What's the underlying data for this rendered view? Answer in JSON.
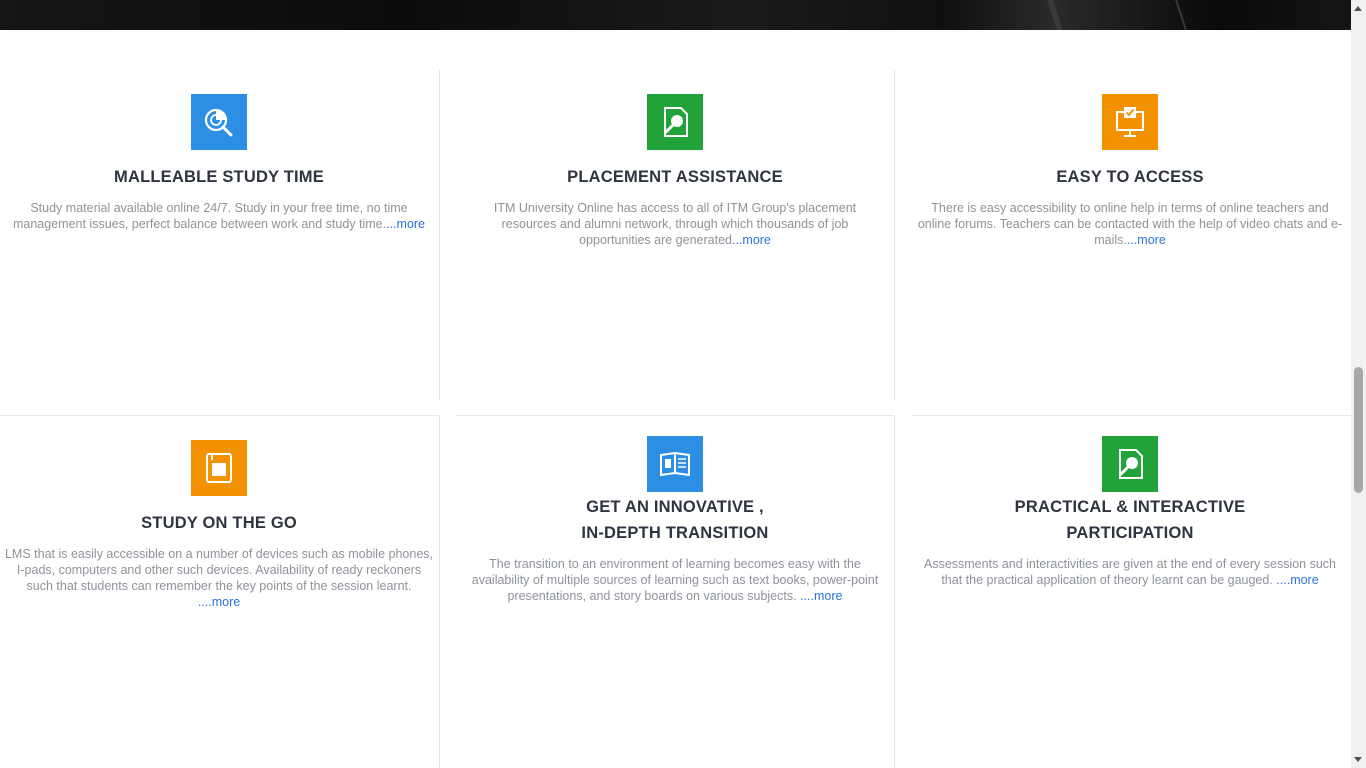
{
  "colors": {
    "blue": "#2d8fe3",
    "green": "#21a33a",
    "orange": "#f39200",
    "title": "#2e3440",
    "desc": "#8e939a",
    "link": "#2a73d6"
  },
  "features": [
    {
      "title": "MALLEABLE STUDY TIME",
      "title_line2": "",
      "icon": "analytics-search-icon",
      "icon_color": "blue",
      "desc": "Study material available online 24/7. Study in your free time, no time management issues, perfect balance between work and study time.",
      "more": "...more"
    },
    {
      "title": "PLACEMENT ASSISTANCE",
      "title_line2": "",
      "icon": "document-search-icon",
      "icon_color": "green",
      "desc": "ITM University Online has access to all of ITM Group's placement resources and alumni network, through which thousands of job opportunities are generated",
      "more": "...more"
    },
    {
      "title": "EASY TO ACCESS",
      "title_line2": "",
      "icon": "monitor-check-icon",
      "icon_color": "orange",
      "desc": "There is easy accessibility to online help in terms of online teachers and online forums. Teachers can be contacted with the help of video chats and e-mails.",
      "more": "...more"
    },
    {
      "title": "STUDY ON THE GO",
      "title_line2": "",
      "icon": "tablet-book-icon",
      "icon_color": "orange",
      "desc": "LMS that is easily accessible on a number of devices such as mobile phones, I-pads, computers and other such devices. Availability of ready reckoners such that students can remember the key points of the session learnt.",
      "more": "....more"
    },
    {
      "title": "GET AN INNOVATIVE ,",
      "title_line2": "IN-DEPTH TRANSITION",
      "icon": "open-book-icon",
      "icon_color": "blue",
      "desc": "The transition to an environment of learning becomes easy with the availability of multiple sources of learning such as text books, power-point presentations, and story boards on various subjects.",
      "more": "....more"
    },
    {
      "title": "PRACTICAL & INTERACTIVE",
      "title_line2": "PARTICIPATION",
      "icon": "document-search-icon",
      "icon_color": "green",
      "desc": "Assessments and interactivities are given at the end of every session such that the practical application of theory learnt can be gauged.",
      "more": "....more"
    }
  ]
}
